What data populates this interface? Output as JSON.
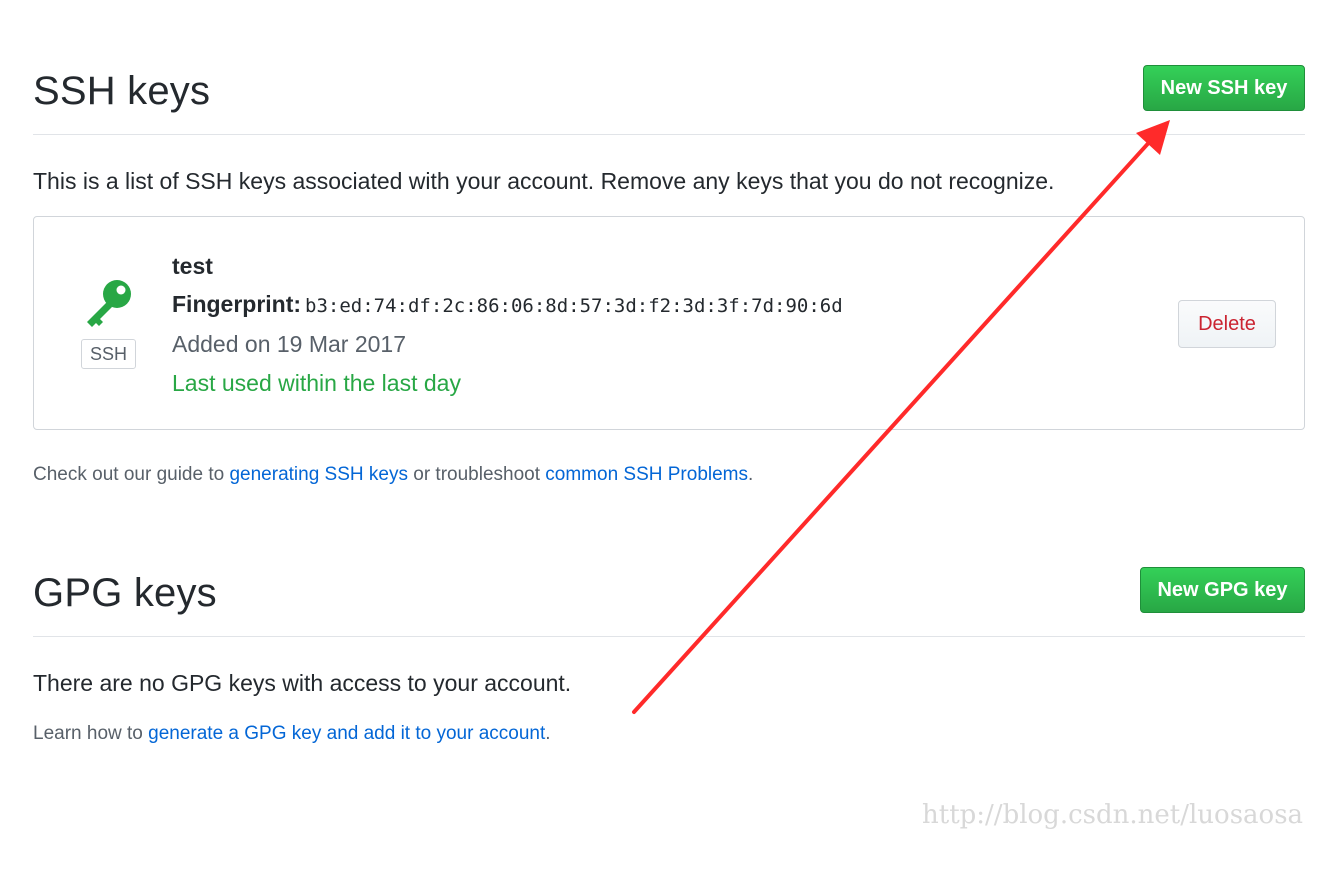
{
  "ssh": {
    "title": "SSH keys",
    "new_button": "New SSH key",
    "intro": "This is a list of SSH keys associated with your account. Remove any keys that you do not recognize.",
    "key": {
      "title": "test",
      "badge": "SSH",
      "fingerprint_label": "Fingerprint:",
      "fingerprint": "b3:ed:74:df:2c:86:06:8d:57:3d:f2:3d:3f:7d:90:6d",
      "added": "Added on 19 Mar 2017",
      "last_used": "Last used within the last day",
      "delete_label": "Delete",
      "icon": "key-icon"
    },
    "help": {
      "prefix": "Check out our guide to ",
      "link1": "generating SSH keys",
      "middle": " or troubleshoot ",
      "link2": "common SSH Problems",
      "suffix": "."
    }
  },
  "gpg": {
    "title": "GPG keys",
    "new_button": "New GPG key",
    "intro": "There are no GPG keys with access to your account.",
    "help": {
      "prefix": "Learn how to ",
      "link": "generate a GPG key and add it to your account",
      "suffix": "."
    }
  },
  "watermark": "http://blog.csdn.net/luosaosa",
  "colors": {
    "accent_green": "#28a745",
    "link_blue": "#0366d6",
    "danger_red": "#cb2431",
    "annotation_red": "#ff2a2a"
  }
}
